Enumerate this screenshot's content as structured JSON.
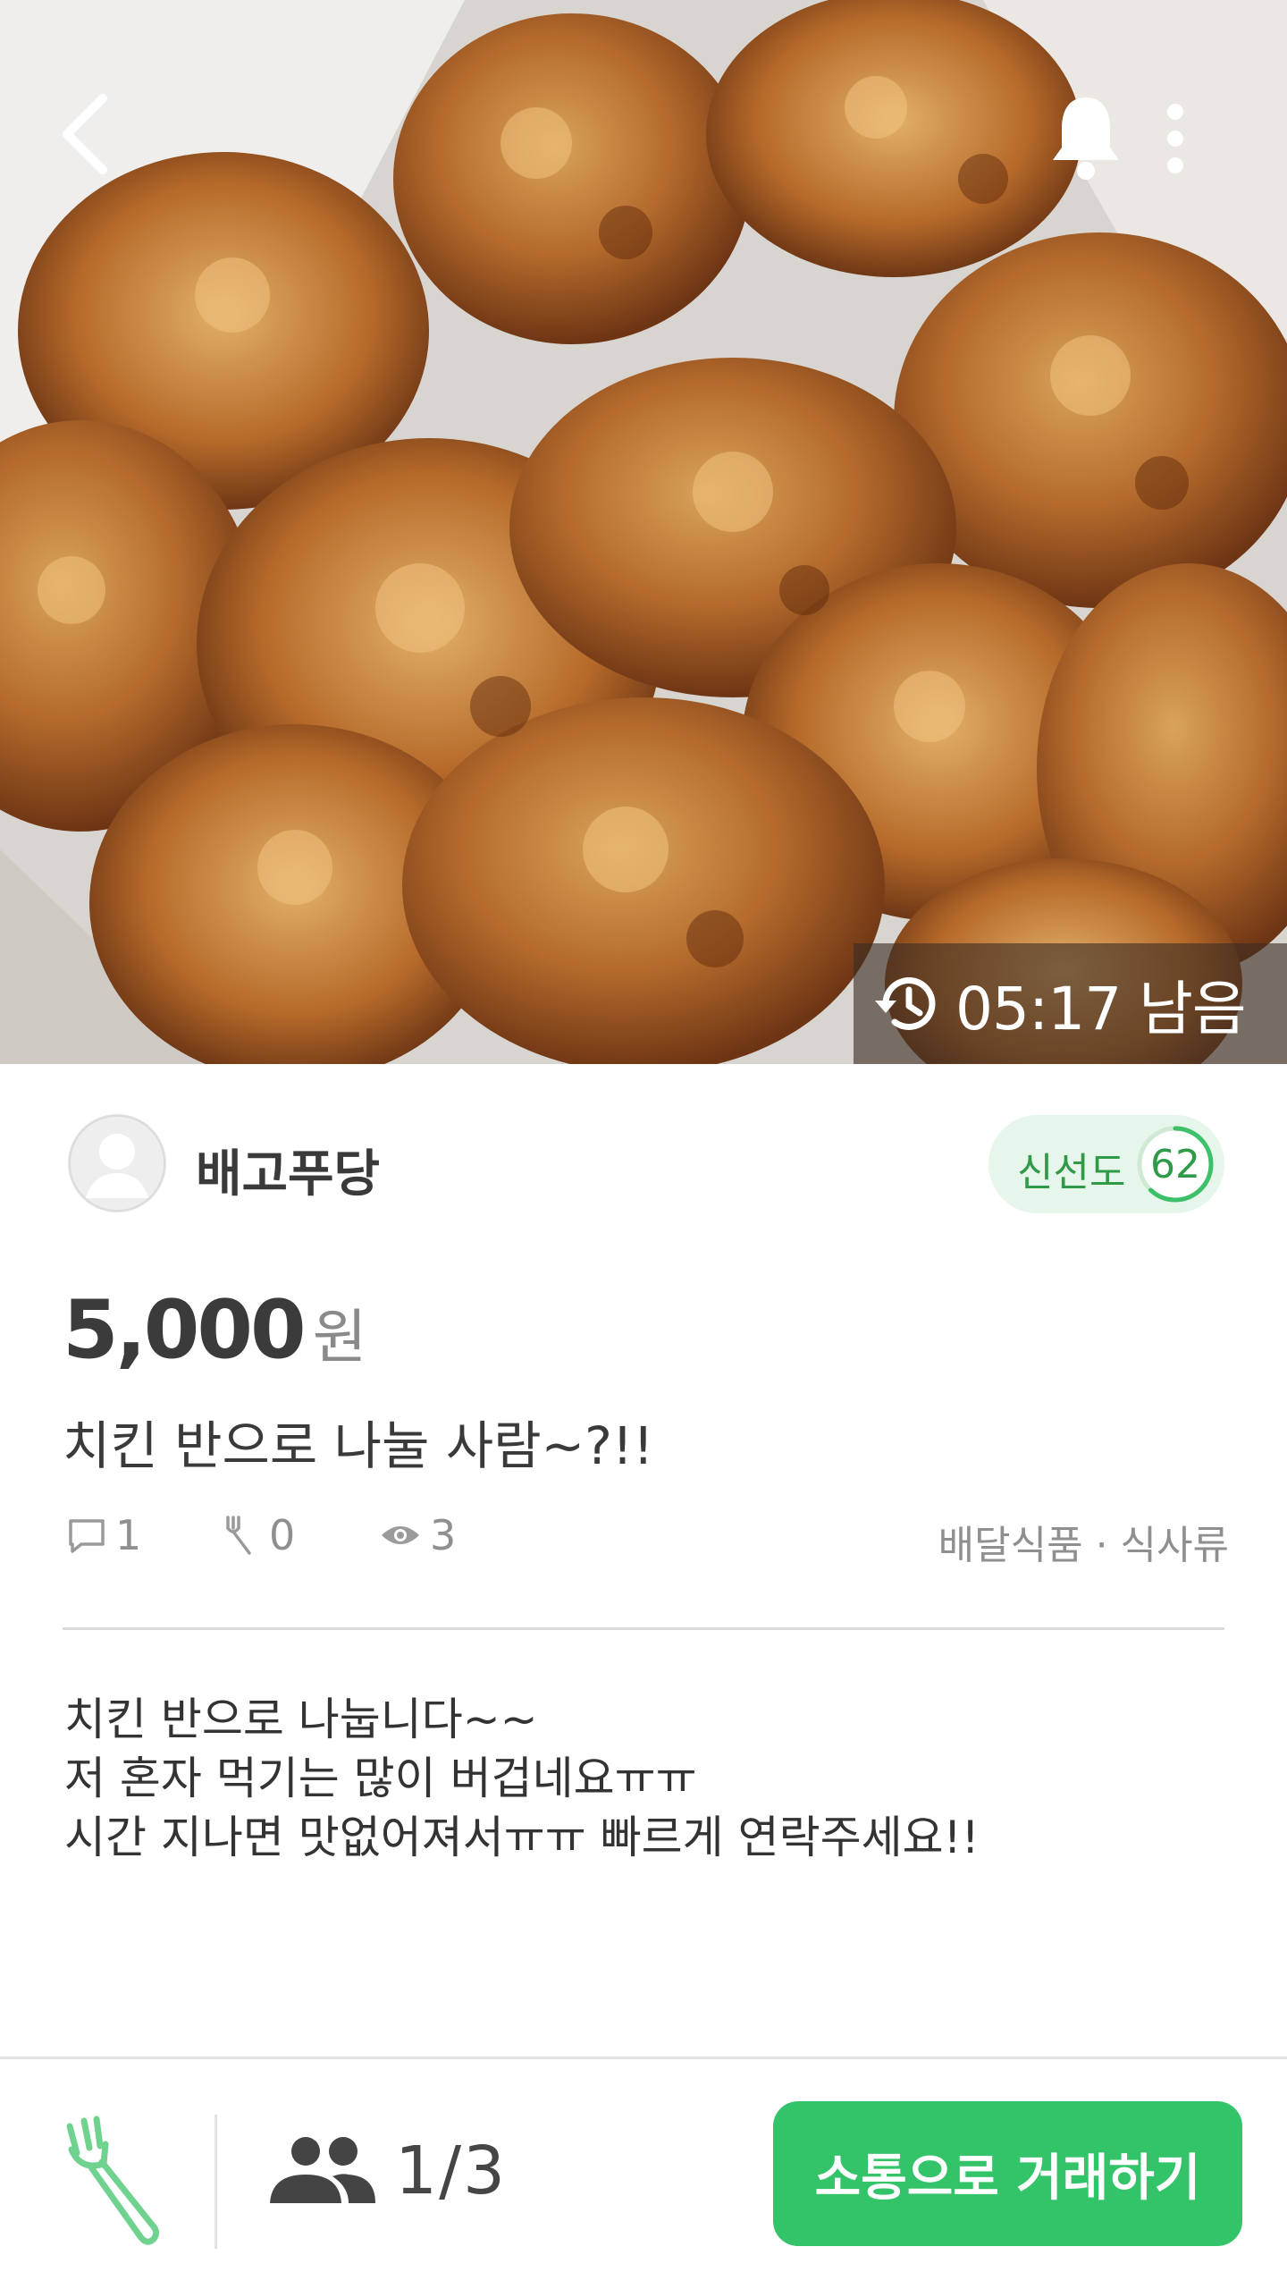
{
  "header": {
    "back_icon": "chevron-left-icon",
    "bell_icon": "bell-icon",
    "more_icon": "more-vertical-icon"
  },
  "timer": {
    "icon": "history-icon",
    "text": "05:17 남음"
  },
  "seller": {
    "name": "배고푸당",
    "avatar_icon": "user-avatar-icon",
    "freshness_label": "신선도",
    "freshness_score": "62",
    "freshness_value": 62
  },
  "post": {
    "price": "5,000",
    "price_unit": "원",
    "title": "치킨 반으로 나눌 사람~?!!",
    "comments": "1",
    "likes": "0",
    "views": "3",
    "category": "배달식품 · 식사류",
    "description": [
      "치킨 반으로 나눕니다~~",
      "저 혼자 먹기는 많이 버겁네요ㅠㅠ",
      "시간 지나면 맛없어져서ㅠㅠ 빠르게 연락주세요!!"
    ]
  },
  "footer": {
    "fork_icon": "fork-icon",
    "people_icon": "people-icon",
    "participants": "1/3",
    "cta_label": "소통으로 거래하기"
  },
  "colors": {
    "accent": "#33c46a",
    "fresh_bg": "#e7f6ea",
    "fresh_text": "#2f9a48"
  }
}
